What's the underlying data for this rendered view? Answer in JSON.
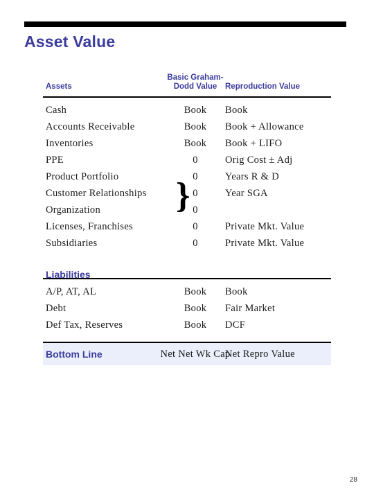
{
  "slide": {
    "title": "Asset Value",
    "page_number": "28",
    "title_color": "#3b3b9e",
    "bar_color": "#000000",
    "band_color": "#eaeffb"
  },
  "table": {
    "headers": {
      "col_assets": "Assets",
      "col_basic": "Basic Graham-\nDodd Value",
      "col_repro": "Reproduction Value"
    },
    "assets_rows": [
      {
        "asset": "Cash",
        "basic": "Book",
        "repro": "Book"
      },
      {
        "asset": "Accounts Receivable",
        "basic": "Book",
        "repro": "Book + Allowance"
      },
      {
        "asset": "Inventories",
        "basic": "Book",
        "repro": "Book + LIFO"
      },
      {
        "asset": "PPE",
        "basic": "0",
        "repro": "Orig Cost ± Adj"
      },
      {
        "asset": "Product Portfolio",
        "basic": "0",
        "repro": "Years R & D"
      },
      {
        "asset": "Customer Relationships",
        "basic": "0",
        "repro": "Year SGA"
      },
      {
        "asset": "Organization",
        "basic": "0",
        "repro": ""
      },
      {
        "asset": "Licenses, Franchises",
        "basic": "0",
        "repro": "Private Mkt. Value"
      },
      {
        "asset": "Subsidiaries",
        "basic": "0",
        "repro": "Private Mkt. Value"
      }
    ],
    "brace_glyph": "}",
    "liabilities_heading": "Liabilities",
    "liabilities_rows": [
      {
        "asset": "A/P, AT, AL",
        "basic": "Book",
        "repro": "Book"
      },
      {
        "asset": "Debt",
        "basic": "Book",
        "repro": "Fair Market"
      },
      {
        "asset": "Def Tax, Reserves",
        "basic": "Book",
        "repro": "DCF"
      }
    ],
    "bottom_line": {
      "label": "Bottom Line",
      "basic": "Net Net Wk Cap",
      "repro": "Net Repro Value"
    }
  }
}
